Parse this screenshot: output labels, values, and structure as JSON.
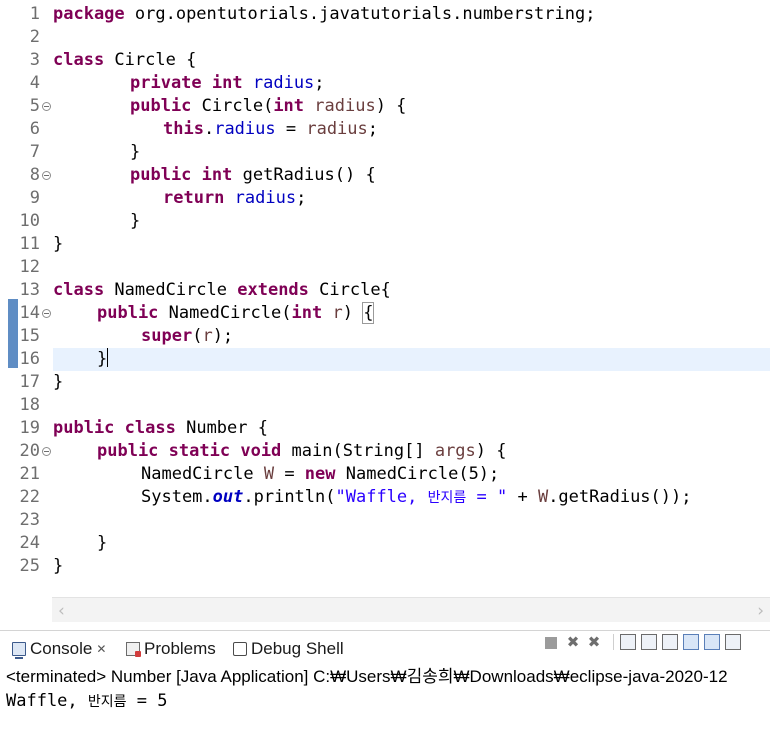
{
  "editor": {
    "line_numbers": [
      "1",
      "2",
      "3",
      "4",
      "5",
      "6",
      "7",
      "8",
      "9",
      "10",
      "11",
      "12",
      "13",
      "14",
      "15",
      "16",
      "17",
      "18",
      "19",
      "20",
      "21",
      "22",
      "23",
      "24",
      "25"
    ],
    "tokens": {
      "package": "package",
      "package_name": " org.opentutorials.javatutorials.numberstring;",
      "class": "class",
      "circle_decl": " Circle {",
      "private": "private",
      "int": "int",
      "radius": "radius",
      "semicolon": ";",
      "public": "public",
      "circle_ctor": " Circle(",
      "space": " ",
      "paren_brace": ") {",
      "this": "this",
      "dot": ".",
      "assign": " = ",
      "close_brace": "}",
      "get_radius": " getRadius() {",
      "return": "return",
      "named_circle": " NamedCircle ",
      "extends": "extends",
      "circle_brace": " Circle{",
      "named_ctor": " NamedCircle(",
      "r": "r",
      "close_paren": ")",
      "open_brace": "{",
      "super": "super",
      "super_args_open": "(",
      "super_args_close": ");",
      "number_decl": " Number {",
      "static": "static",
      "void": "void",
      "main_decl": " main(String[] ",
      "args": "args",
      "named_type": "NamedCircle ",
      "var_w": "W",
      "new": "new",
      "new_ctor": " NamedCircle(5);",
      "system": "System.",
      "out": "out",
      "println": ".println(",
      "str_open": "\"Waffle, ",
      "str_kr": "반지름",
      "str_close": " = \"",
      "plus": " + ",
      "get_call": ".getRadius());"
    }
  },
  "console": {
    "tabs": [
      {
        "label": "Console",
        "icon": "console-icon",
        "active": true
      },
      {
        "label": "Problems",
        "icon": "problems-icon",
        "active": false
      },
      {
        "label": "Debug Shell",
        "icon": "debug-shell-icon",
        "active": false
      }
    ],
    "close_glyph": "✕",
    "header": "<terminated> Number [Java Application] C:₩Users₩김송희₩Downloads₩eclipse-java-2020-12",
    "output_prefix": "Waffle, ",
    "output_kr": "반지름",
    "output_suffix": " = 5"
  },
  "scrollbar": {
    "left_arrow": "‹",
    "right_arrow": "›"
  },
  "toolbar": {
    "remove_glyph": "✖",
    "remove_all_glyph": "✖"
  },
  "colors": {
    "keyword": "#7f0055",
    "field": "#0000c0",
    "parameter": "#6a3e3e",
    "string": "#2a00ff",
    "current_line": "#e8f2fe",
    "change_marker": "#5f8dc4"
  }
}
